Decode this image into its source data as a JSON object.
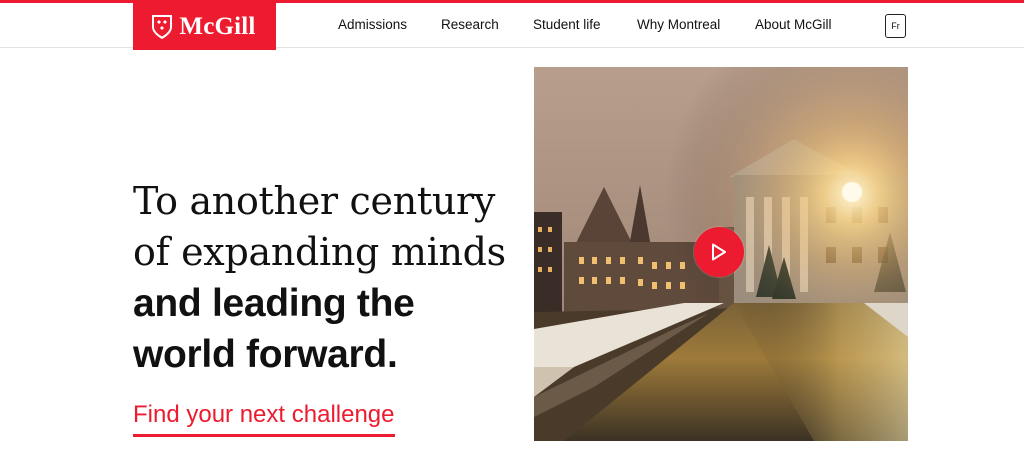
{
  "brand": {
    "name": "McGill",
    "color": "#ed1b2f",
    "icon": "mcgill-crest-icon"
  },
  "nav": {
    "items": [
      {
        "label": "Admissions"
      },
      {
        "label": "Research"
      },
      {
        "label": "Student life"
      },
      {
        "label": "Why Montreal"
      },
      {
        "label": "About McGill"
      }
    ],
    "language_toggle": "Fr"
  },
  "hero": {
    "headline_light": [
      "To another century",
      "of expanding minds"
    ],
    "headline_bold": [
      "and leading the",
      "world forward."
    ],
    "cta_label": "Find your next challenge",
    "video_button_icon": "play-icon",
    "image": "campus-night-winter-photo"
  }
}
